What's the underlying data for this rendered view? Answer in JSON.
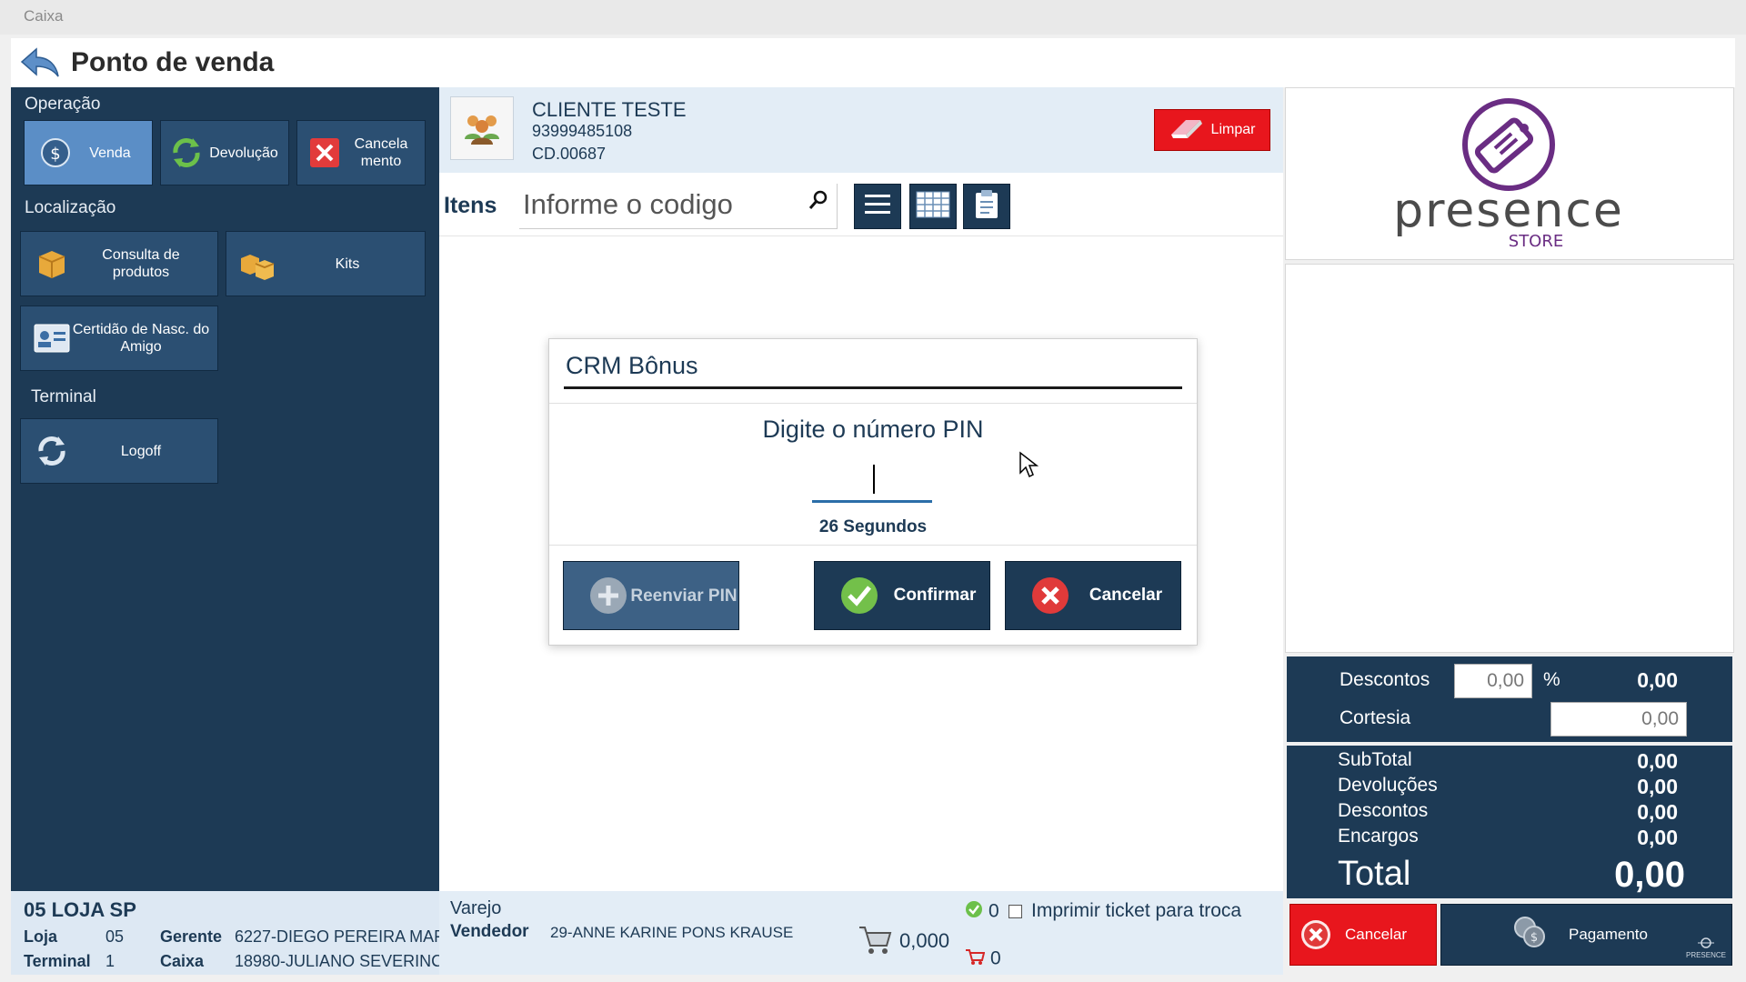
{
  "window": {
    "title": "Caixa"
  },
  "header": {
    "title": "Ponto de venda"
  },
  "left": {
    "operacao_label": "Operação",
    "venda": "Venda",
    "devolucao": "Devolução",
    "cancelamento": "Cancela mento",
    "localizacao_label": "Localização",
    "consulta": "Consulta de produtos",
    "kits": "Kits",
    "certidao": "Certidão de Nasc. do Amigo",
    "terminal_label": "Terminal",
    "logoff": "Logoff"
  },
  "store": {
    "name": "05 LOJA SP",
    "loja_label": "Loja",
    "loja_value": "05",
    "gerente_label": "Gerente",
    "gerente_value": "6227-DIEGO PEREIRA MAF",
    "terminal_label": "Terminal",
    "terminal_value": "1",
    "caixa_label": "Caixa",
    "caixa_value": "18980-JULIANO SEVERINC"
  },
  "client": {
    "name": "CLIENTE TESTE",
    "phone": "93999485108",
    "code": "CD.00687",
    "limpar": "Limpar"
  },
  "items": {
    "label": "Itens",
    "search_placeholder": "Informe o codigo"
  },
  "dialog": {
    "title": "CRM Bônus",
    "prompt": "Digite o número PIN",
    "pin_value": "",
    "timer": "26 Segundos",
    "resend": "Reenviar PIN",
    "confirm": "Confirmar",
    "cancel": "Cancelar"
  },
  "footer": {
    "channel": "Varejo",
    "vendedor_label": "Vendedor",
    "vendedor_value": "29-ANNE KARINE PONS KRAUSE",
    "quantity": "0,000",
    "count_checked": "0",
    "count_cart": "0",
    "print_ticket_label": "Imprimir ticket para troca",
    "print_ticket_checked": false
  },
  "logo": {
    "brand": "presence",
    "sub": "STORE"
  },
  "discounts": {
    "descontos_label": "Descontos",
    "descontos_input": "0,00",
    "percent_sign": "%",
    "descontos_value": "0,00",
    "cortesia_label": "Cortesia",
    "cortesia_input": "0,00"
  },
  "totals": {
    "subtotal_label": "SubTotal",
    "subtotal_value": "0,00",
    "devolucoes_label": "Devoluções",
    "devolucoes_value": "0,00",
    "descontos_label": "Descontos",
    "descontos_value": "0,00",
    "encargos_label": "Encargos",
    "encargos_value": "0,00",
    "total_label": "Total",
    "total_value": "0,00"
  },
  "actions": {
    "cancelar": "Cancelar",
    "pagamento": "Pagamento",
    "brand_small": "PRESENCE"
  },
  "colors": {
    "navy": "#1d3a55",
    "tile": "#2b4f72",
    "active_tile": "#5b8ec6",
    "danger": "#e8161d",
    "brand_purple": "#6a2d83"
  }
}
